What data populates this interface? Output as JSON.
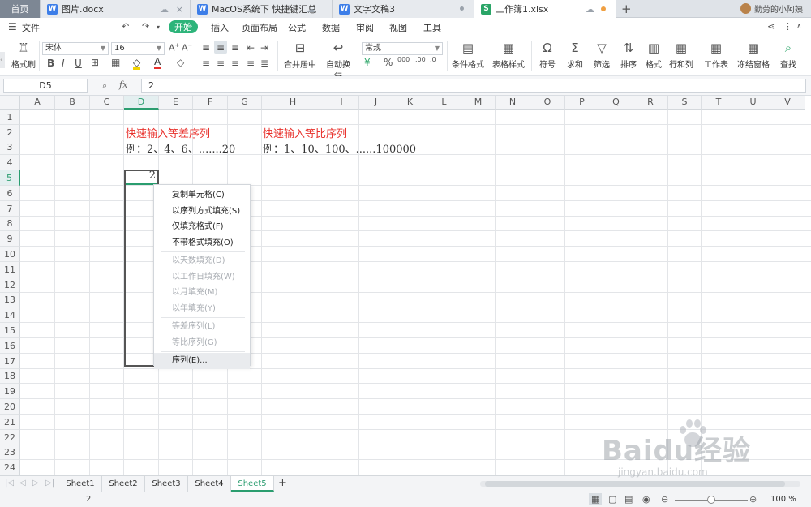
{
  "tabs": [
    {
      "label": "首页",
      "type": "home"
    },
    {
      "label": "图片.docx",
      "type": "doc"
    },
    {
      "label": "MacOS系统下 快捷键汇总",
      "type": "doc"
    },
    {
      "label": "文字文稿3",
      "type": "doc"
    },
    {
      "label": "工作簿1.xlsx",
      "type": "xls"
    }
  ],
  "user": {
    "name": "勤劳的小阿姨"
  },
  "menu": {
    "file": "文件",
    "items": [
      "开始",
      "插入",
      "页面布局",
      "公式",
      "数据",
      "审阅",
      "视图",
      "工具"
    ]
  },
  "ribbon": {
    "format_painter": "格式刷",
    "font_name": "宋体",
    "font_size": "16",
    "merge_center": "合并居中",
    "wrap_text": "自动换行",
    "number_format": "常规",
    "conditional_format": "条件格式",
    "table_style": "表格样式",
    "symbol": "符号",
    "sum": "求和",
    "filter": "筛选",
    "sort": "排序",
    "format": "格式",
    "row_col": "行和列",
    "worksheet": "工作表",
    "freeze": "冻结窗格",
    "find": "查找"
  },
  "formula_bar": {
    "name_box": "D5",
    "fx": "fx",
    "value": "2"
  },
  "columns": [
    "A",
    "B",
    "C",
    "D",
    "E",
    "F",
    "G",
    "H",
    "I",
    "J",
    "K",
    "L",
    "M",
    "N",
    "O",
    "P",
    "Q",
    "R",
    "S",
    "T",
    "U",
    "V"
  ],
  "rows": [
    "1",
    "2",
    "3",
    "4",
    "5",
    "6",
    "7",
    "8",
    "9",
    "10",
    "11",
    "12",
    "13",
    "14",
    "15",
    "16",
    "17",
    "18",
    "19",
    "20",
    "21",
    "22",
    "23",
    "24"
  ],
  "cells": {
    "d2": "快速输入等差序列",
    "d3": "例：2、4、6、.......20",
    "h2": "快速输入等比序列",
    "h3": "例：1、10、100、......100000",
    "d5": "2"
  },
  "context_menu": {
    "items": [
      {
        "label": "复制单元格(C)",
        "enabled": true
      },
      {
        "label": "以序列方式填充(S)",
        "enabled": true
      },
      {
        "label": "仅填充格式(F)",
        "enabled": true
      },
      {
        "label": "不带格式填充(O)",
        "enabled": true
      },
      {
        "label": "以天数填充(D)",
        "enabled": false
      },
      {
        "label": "以工作日填充(W)",
        "enabled": false
      },
      {
        "label": "以月填充(M)",
        "enabled": false
      },
      {
        "label": "以年填充(Y)",
        "enabled": false
      },
      {
        "label": "等差序列(L)",
        "enabled": false
      },
      {
        "label": "等比序列(G)",
        "enabled": false
      },
      {
        "label": "序列(E)...",
        "enabled": true
      }
    ]
  },
  "sheets": [
    "Sheet1",
    "Sheet2",
    "Sheet3",
    "Sheet4",
    "Sheet5"
  ],
  "active_sheet": "Sheet5",
  "status": {
    "value": "2",
    "zoom": "100 %"
  },
  "watermark": {
    "text": "Baidu经验",
    "sub": "jingyan.baidu.com"
  },
  "colors": {
    "accent": "#2db47a",
    "red_text": "#e8312c"
  }
}
